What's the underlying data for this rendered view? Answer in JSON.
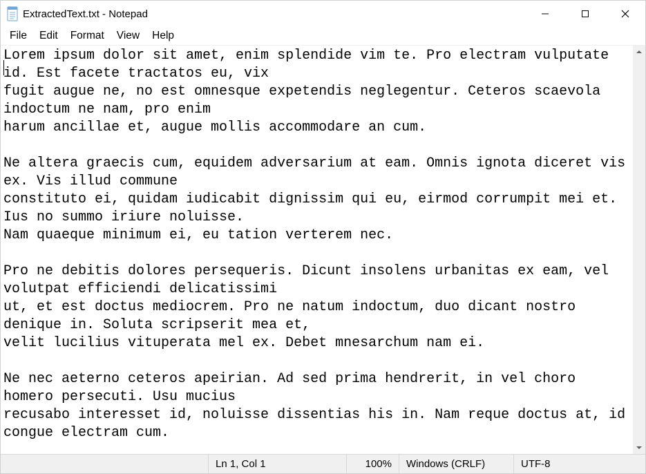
{
  "window": {
    "title": "ExtractedText.txt - Notepad"
  },
  "menu": {
    "file": "File",
    "edit": "Edit",
    "format": "Format",
    "view": "View",
    "help": "Help"
  },
  "document": {
    "content": "Lorem ipsum dolor sit amet, enim splendide vim te. Pro electram vulputate id. Est facete tractatos eu, vix\nfugit augue ne, no est omnesque expetendis neglegentur. Ceteros scaevola indoctum ne nam, pro enim\nharum ancillae et, augue mollis accommodare an cum.\n\nNe altera graecis cum, equidem adversarium at eam. Omnis ignota diceret vis ex. Vis illud commune\nconstituto ei, quidam iudicabit dignissim qui eu, eirmod corrumpit mei et. Ius no summo iriure noluisse.\nNam quaeque minimum ei, eu tation verterem nec.\n\nPro ne debitis dolores persequeris. Dicunt insolens urbanitas ex eam, vel volutpat efficiendi delicatissimi\nut, et est doctus mediocrem. Pro ne natum indoctum, duo dicant nostro denique in. Soluta scripserit mea et,\nvelit lucilius vituperata mel ex. Debet mnesarchum nam ei.\n\nNe nec aeterno ceteros apeirian. Ad sed prima hendrerit, in vel choro homero persecuti. Usu mucius\nrecusabo interesset id, noluisse dissentias his in. Nam reque doctus at, id congue electram cum."
  },
  "status": {
    "position": "Ln 1, Col 1",
    "zoom": "100%",
    "line_ending": "Windows (CRLF)",
    "encoding": "UTF-8"
  }
}
